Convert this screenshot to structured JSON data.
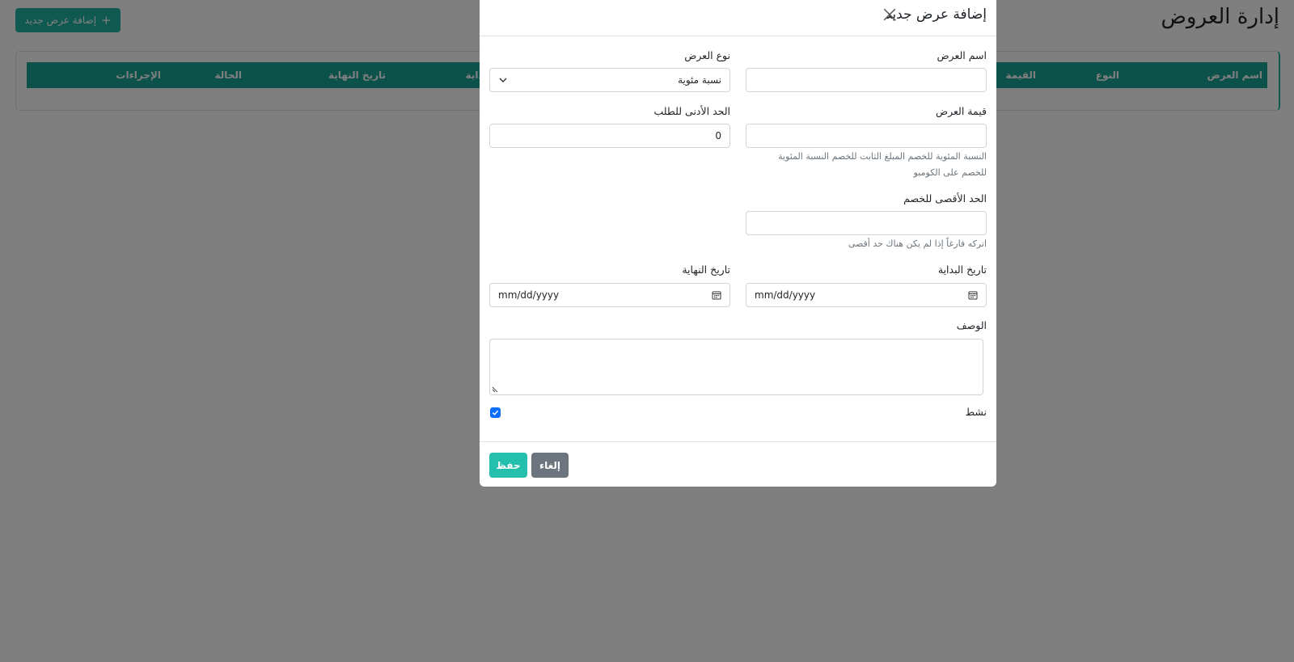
{
  "page": {
    "title": "إدارة العروض",
    "add_button_label": "إضافة عرض جديد",
    "table_headers": [
      "اسم العرض",
      "النوع",
      "القيمة",
      "البداية",
      "تاريخ النهاية",
      "الحالة",
      "الإجراءات"
    ]
  },
  "modal": {
    "title": "إضافة عرض جديد",
    "fields": {
      "offer_name": {
        "label": "اسم العرض",
        "value": ""
      },
      "offer_type": {
        "label": "نوع العرض",
        "value": "نسبة مئوية"
      },
      "offer_value": {
        "label": "قيمة العرض",
        "value": "",
        "help": "النسبة المئوية للخصم المبلغ الثابت للخصم النسبة المئوية للخصم على الكومبو"
      },
      "min_order": {
        "label": "الحد الأدنى للطلب",
        "value": "0"
      },
      "max_discount": {
        "label": "الحد الأقصى للخصم",
        "value": "",
        "help": "اتركه فارغاً إذا لم يكن هناك حد أقصى"
      },
      "start_date": {
        "label": "تاريخ البداية",
        "placeholder": "mm/dd/yyyy"
      },
      "end_date": {
        "label": "تاريخ النهاية",
        "placeholder": "mm/dd/yyyy"
      },
      "description": {
        "label": "الوصف",
        "value": ""
      },
      "active": {
        "label": "نشط",
        "checked": true
      }
    },
    "save_label": "حفظ",
    "cancel_label": "إلغاء"
  },
  "icons": {
    "close": "close-icon",
    "select_chevron": "chevron-down-icon",
    "calendar": "calendar-icon",
    "plus": "plus-icon"
  },
  "colors": {
    "accent": "#20b2a0",
    "save": "#25bfae",
    "cancel": "#6c757d",
    "checkbox": "#0d6efd"
  }
}
